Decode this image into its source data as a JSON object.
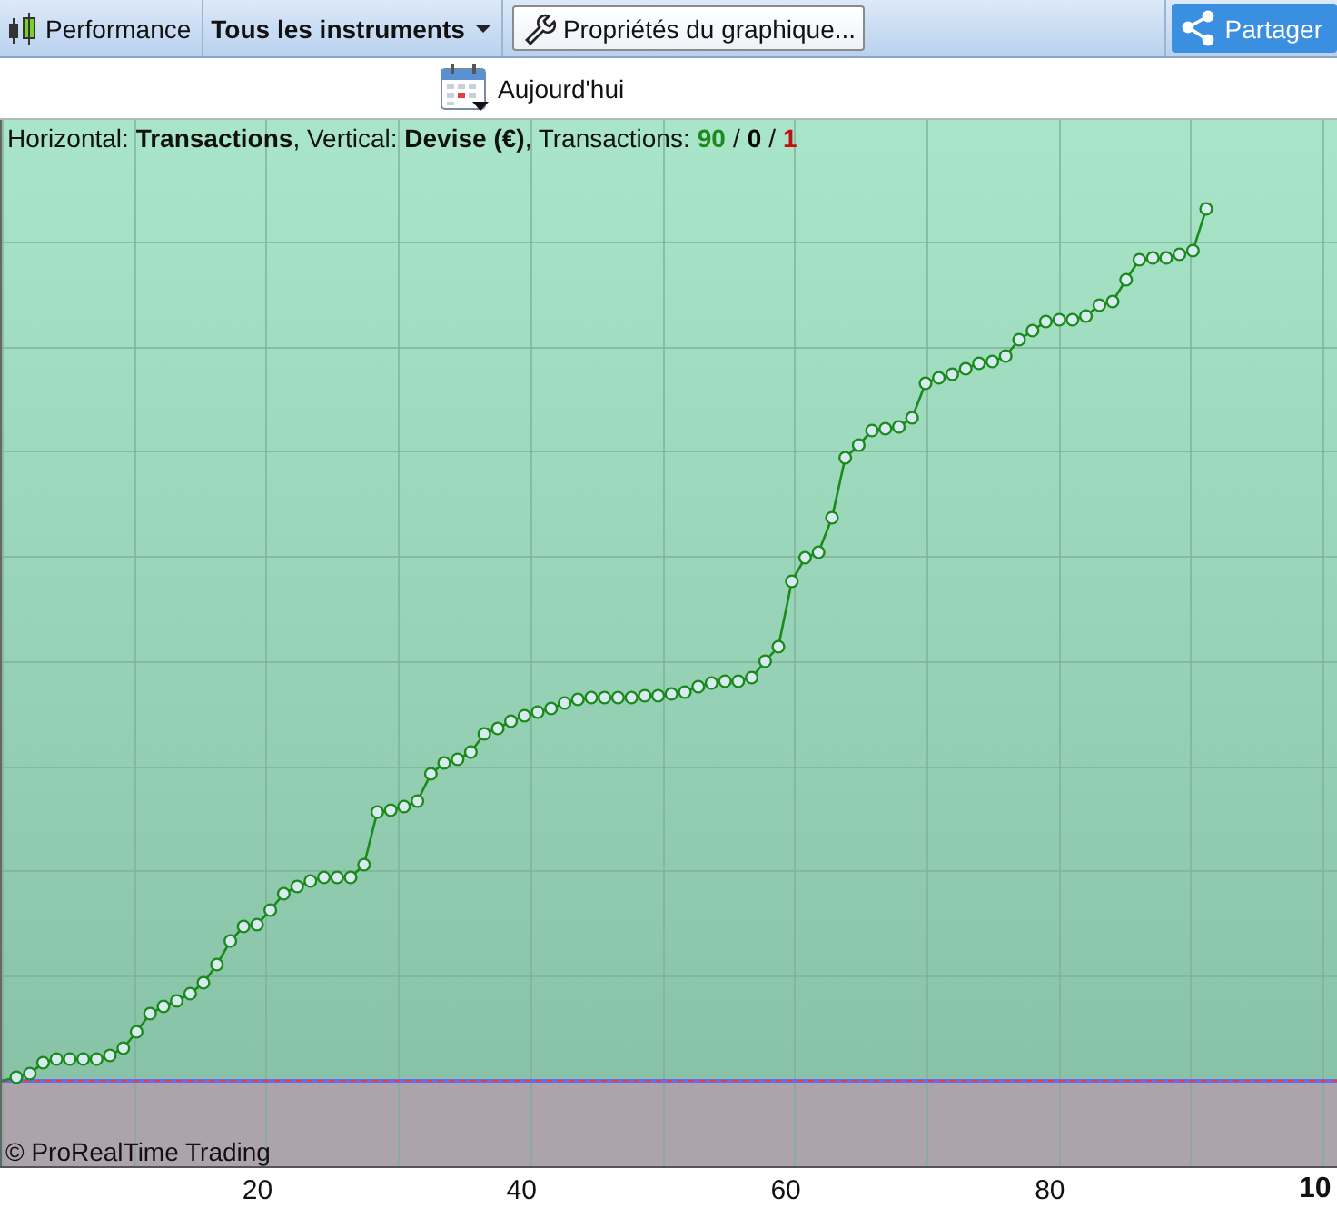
{
  "toolbar": {
    "items": [
      {
        "kind": "view",
        "label": "Performance"
      },
      {
        "kind": "dropdown",
        "label": "Tous les instruments"
      },
      {
        "kind": "button",
        "label": "Propriétés du graphique..."
      }
    ],
    "share_button": {
      "label": "Partager"
    }
  },
  "date_selector": {
    "label": "Aujourd'hui"
  },
  "chart": {
    "legend": "Horizontal: **Transactions**, Vertical: **Devise (€)**, Transactions:",
    "transaction_counts": [
      {
        "value": "90",
        "color": "#1e8a1e"
      },
      {
        "value": "0",
        "color": "#000000"
      },
      {
        "value": "1",
        "color": "#c01010"
      }
    ],
    "separators": [
      "/",
      "/"
    ],
    "copyright": "© ProRealTime Trading",
    "x_axis_labels": [
      {
        "label": "20",
        "emphasized": false
      },
      {
        "label": "40",
        "emphasized": false
      },
      {
        "label": "60",
        "emphasized": false
      },
      {
        "label": "80",
        "emphasized": false
      },
      {
        "label": "10",
        "emphasized": true
      }
    ]
  }
}
